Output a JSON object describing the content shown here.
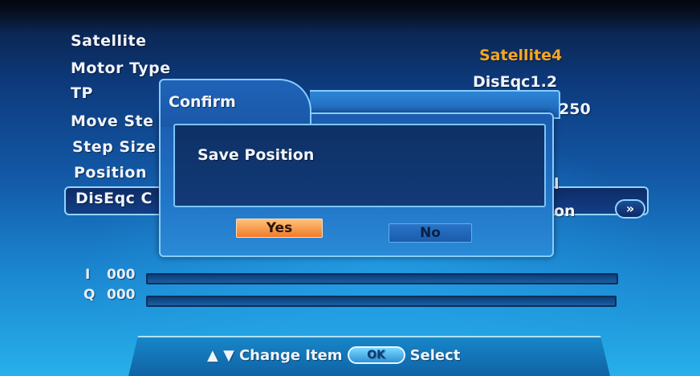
{
  "menu": {
    "items": [
      {
        "label": "Satellite",
        "value": "Satellite4"
      },
      {
        "label": "Motor Type",
        "value": "DisEqc1.2"
      },
      {
        "label": "TP",
        "value": "250"
      },
      {
        "label": "Move Ste",
        "value": ""
      },
      {
        "label": "Step Size",
        "value": ""
      },
      {
        "label": "Position",
        "value": "l"
      },
      {
        "label": "DisEqc C",
        "value": "on"
      }
    ],
    "arrow_glyph": "»"
  },
  "meters": {
    "i_label": "I",
    "i_value": "000",
    "q_label": "Q",
    "q_value": "000"
  },
  "dialog": {
    "title": "Confirm",
    "message": "Save Position",
    "yes_label": "Yes",
    "no_label": "No"
  },
  "help": {
    "arrows": "▲ ▼",
    "change_item": "Change Item",
    "ok_label": "OK",
    "select": "Select"
  },
  "colors": {
    "accent_value": "#f5a623",
    "yes_button": "#f07a2a",
    "dialog_border": "#86cdff"
  }
}
